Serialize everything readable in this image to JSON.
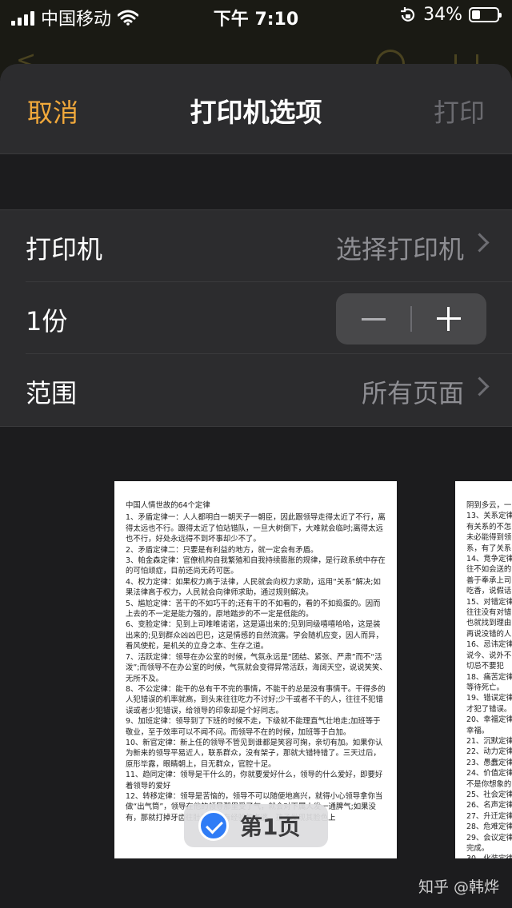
{
  "status_bar": {
    "carrier": "中国移动",
    "time": "下午 7:10",
    "battery": "34%",
    "battery_level": 0.34
  },
  "navbar": {
    "cancel": "取消",
    "title": "打印机选项",
    "print": "打印"
  },
  "rows": {
    "printer_label": "打印机",
    "printer_value": "选择打印机",
    "copies_label": "1份",
    "range_label": "范围",
    "range_value": "所有页面"
  },
  "preview": {
    "page1_title": "中国人情世故的64个定律",
    "page1_text": "1、矛盾定律一：人人都明白一朝天子一朝臣，因此跟领导走得太近了不行，离得太远也不行。跟得太近了怕站错队，一旦大树倒下，大难就会临时;离得太远也不行，好处永远得不到坏事却少不了。\n2、矛盾定律二：只要是有利益的地方，就一定会有矛盾。\n3、帕金森定律：官僚机构自我繁殖和自我持续膨胀的规律，是行政系统中存在的可怕顽症，目前还尚无药可医。\n4、权力定律：如果权力高于法律，人民就会向权力求助，运用“关系”解决;如果法律高于权力，人民就会向律师求助，通过规则解决。\n5、尴尬定律：苦干的不如巧干的;还有干的不如看的，看的不如捣蛋的。因而上去的不一定是能力强的，原地踏步的不一定是低能的。\n6、变脸定律：见到上司唯唯诺诺，这是逼出来的;见到同级嘻嘻哈哈，这是装出来的;见到群众凶凶巴巴，这是情感的自然流露。学会随机应变，因人而异，看风使舵，是机关的立身之本、生存之道。\n7、活跃定律：领导在办公室的时候，气氛永远是“团结、紧张、严肃”而不“活泼”;而领导不在办公室的时候，气氛就会变得异常活跃，海阔天空，说说笑笑、无所不及。\n8、不公定律：能干的总有干不完的事情，不能干的总是没有事情干。干得多的人犯错误的机率就高，到头来往往吃力不讨好;少干或者不干的人，往往不犯错误或者少犯错误，给领导的印象却是个好同志。\n9、加班定律：领导到了下班的时候不走，下级就不能理直气壮地走;加班等于敬业，至于效率可以不闻不问。而领导不在的时候，加班等于白加。\n10、新官定律：新上任的领导不管见到谁都是笑容可掬，亲切有加。如果你认为新来的领导平易近人，联系群众，没有架子，那就大错特错了。三天过后，原形毕露，眼睛朝上，目无群众，官腔十足。\n11、趋同定律：领导是干什么的，你就要爱好什么，领导的什么爱好，即要好着领导的爱好\n12、转移定律：领导是苦恼的，领导不可以随便地高兴，就得小心领导拿你当做“出气筒”，领导在他的领导那里受了气，就会对下属人发一通脾气;如果没有，那就打掉牙齿往肚里咽。有经验的老婆、孩子发现其脸色上",
    "page2_text": "阴到多云，一\n13、关系定律\n有关系的不怎\n未必能得到领\n系，有了关系\n14、竞争定律\n往不如会送的\n善于奉承上司\n吃香，说假话\n15、对错定律\n往往没有对错\n也就找到理由\n再说没错的人\n16、忌讳定律\n说今、说外不\n切忌不要犯\n18、痛苦定律\n等待死亡。\n19、错误定律\n才犯了错误。\n20、幸福定律\n幸福。\n21、沉默定律\n22、动力定律\n23、愚蠢定律\n24、价值定律\n不是你想象的\n25、社会定律\n26、名声定律\n27、升迁定律\n28、危难定律\n29、会议定律\n完成。\n30、化装定律",
    "page_badge": "第1页"
  },
  "watermark": "知乎 @韩烨",
  "colors": {
    "accent": "#f2a93b",
    "badge_check": "#2f7cf6"
  },
  "icons": [
    "signal-icon",
    "wifi-icon",
    "rotation-lock-icon",
    "battery-icon",
    "chevron-right-icon",
    "minus-icon",
    "plus-icon",
    "checkmark-icon"
  ]
}
